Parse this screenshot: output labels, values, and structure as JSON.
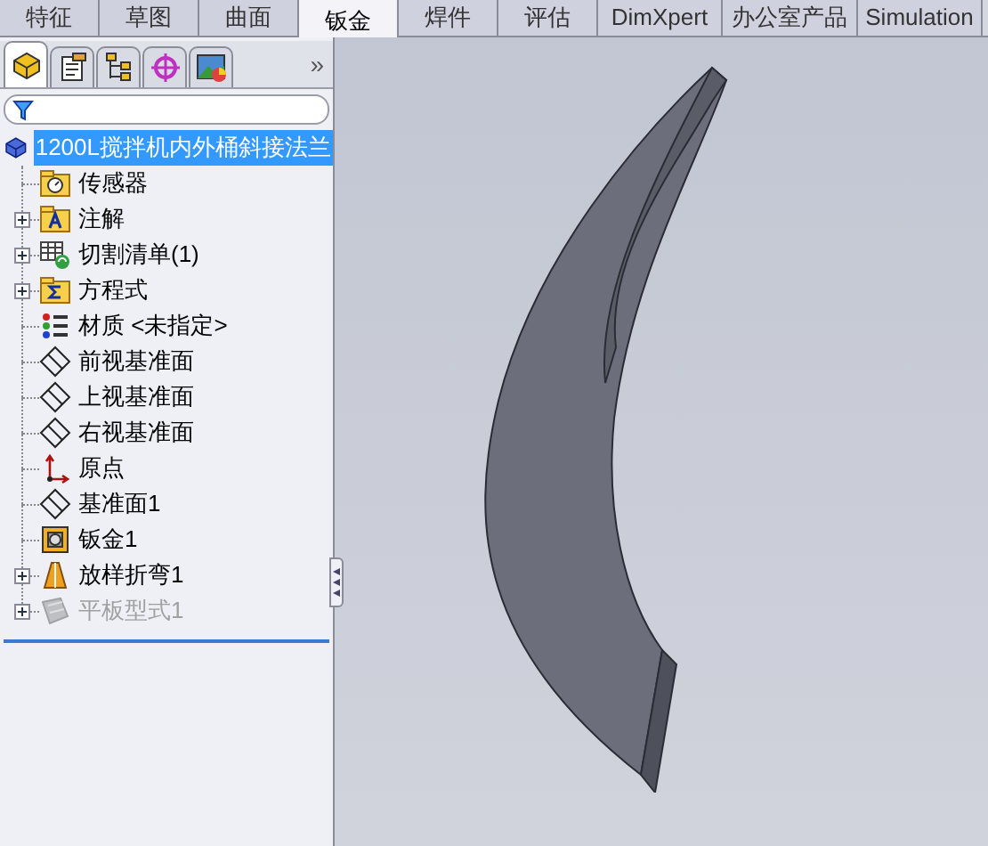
{
  "command_tabs": [
    {
      "label": "特征",
      "selected": false
    },
    {
      "label": "草图",
      "selected": false
    },
    {
      "label": "曲面",
      "selected": false
    },
    {
      "label": "钣金",
      "selected": true
    },
    {
      "label": "焊件",
      "selected": false
    },
    {
      "label": "评估",
      "selected": false
    },
    {
      "label": "DimXpert",
      "selected": false
    },
    {
      "label": "办公室产品",
      "selected": false
    },
    {
      "label": "Simulation",
      "selected": false
    }
  ],
  "panel_tabs": [
    {
      "kind": "feature-tree",
      "selected": true
    },
    {
      "kind": "property",
      "selected": false
    },
    {
      "kind": "config",
      "selected": false
    },
    {
      "kind": "dimxpert",
      "selected": false
    },
    {
      "kind": "display",
      "selected": false
    }
  ],
  "panel_more": "»",
  "tree": {
    "root": {
      "label": "1200L搅拌机内外桶斜接法兰",
      "selected": true
    },
    "items": [
      {
        "kind": "sensor",
        "label": "传感器",
        "disabled": false
      },
      {
        "kind": "annotation",
        "label": "注解",
        "expanded": false,
        "disabled": false
      },
      {
        "kind": "cutlist",
        "label": "切割清单(1)",
        "expanded": false,
        "disabled": false
      },
      {
        "kind": "equation",
        "label": "方程式",
        "expanded": false,
        "disabled": false
      },
      {
        "kind": "material",
        "label": "材质 <未指定>",
        "disabled": false
      },
      {
        "kind": "plane",
        "label": "前视基准面",
        "disabled": false
      },
      {
        "kind": "plane",
        "label": "上视基准面",
        "disabled": false
      },
      {
        "kind": "plane",
        "label": "右视基准面",
        "disabled": false
      },
      {
        "kind": "origin",
        "label": "原点",
        "disabled": false
      },
      {
        "kind": "plane",
        "label": "基准面1",
        "disabled": false
      },
      {
        "kind": "sheetmetal",
        "label": "钣金1",
        "disabled": false
      },
      {
        "kind": "loft",
        "label": "放样折弯1",
        "expanded": false,
        "disabled": false
      },
      {
        "kind": "flat",
        "label": "平板型式1",
        "expanded": false,
        "disabled": true
      }
    ]
  }
}
